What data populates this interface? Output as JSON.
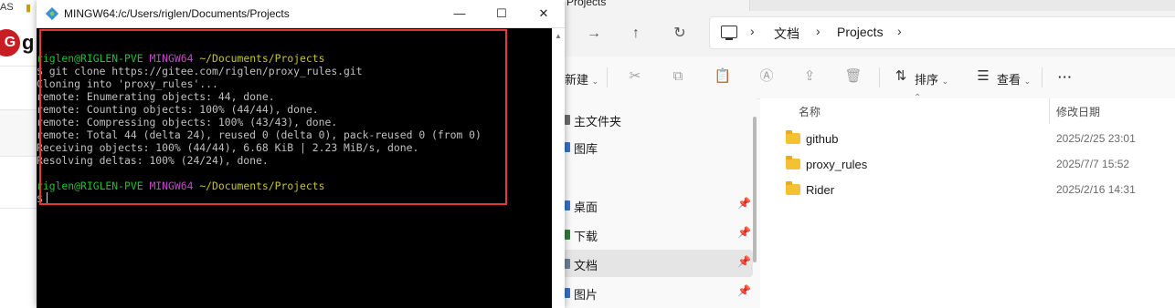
{
  "background_app": {
    "top_text": "AS",
    "badge_letter": "G",
    "brand_letter": "g"
  },
  "explorer": {
    "window_title": "Projects",
    "nav": {
      "back_icon": "arrow-left-icon",
      "forward_icon": "arrow-right-icon",
      "up_icon": "arrow-up-icon",
      "refresh_icon": "refresh-icon"
    },
    "breadcrumb": [
      "文档",
      "Projects"
    ],
    "toolbar": {
      "new_label": "新建",
      "sort_label": "排序",
      "view_label": "查看",
      "more_label": "···"
    },
    "sidebar": [
      {
        "label": "主文件夹",
        "pinned": false
      },
      {
        "label": "图库",
        "pinned": false
      },
      {
        "label": "桌面",
        "pinned": true
      },
      {
        "label": "下载",
        "pinned": true
      },
      {
        "label": "文档",
        "pinned": true,
        "selected": true
      },
      {
        "label": "图片",
        "pinned": true
      }
    ],
    "columns": {
      "name": "名称",
      "modified": "修改日期"
    },
    "files": [
      {
        "name": "github",
        "modified": "2025/2/25 23:01"
      },
      {
        "name": "proxy_rules",
        "modified": "2025/7/7 15:52"
      },
      {
        "name": "Rider",
        "modified": "2025/2/16 14:31"
      }
    ]
  },
  "terminal": {
    "title": "MINGW64:/c/Users/riglen/Documents/Projects",
    "controls": {
      "minimize": "—",
      "maximize": "☐",
      "close": "✕"
    },
    "prompt1": {
      "user": "riglen@RIGLEN-PVE",
      "env": "MINGW64",
      "path": "~/Documents/Projects"
    },
    "command": "$ git clone https://gitee.com/riglen/proxy_rules.git",
    "output": [
      "Cloning into 'proxy_rules'...",
      "remote: Enumerating objects: 44, done.",
      "remote: Counting objects: 100% (44/44), done.",
      "remote: Compressing objects: 100% (43/43), done.",
      "remote: Total 44 (delta 24), reused 0 (delta 0), pack-reused 0 (from 0)",
      "Receiving objects: 100% (44/44), 6.68 KiB | 2.23 MiB/s, done.",
      "Resolving deltas: 100% (24/24), done."
    ],
    "prompt2": {
      "user": "riglen@RIGLEN-PVE",
      "env": "MINGW64",
      "path": "~/Documents/Projects"
    },
    "prompt_symbol": "$"
  },
  "colors": {
    "terminal_bg": "#000000",
    "prompt_user": "#13c72a",
    "prompt_env": "#c24bc8",
    "prompt_path": "#c8c428",
    "highlight_box": "#e53935",
    "folder": "#f3c234"
  }
}
